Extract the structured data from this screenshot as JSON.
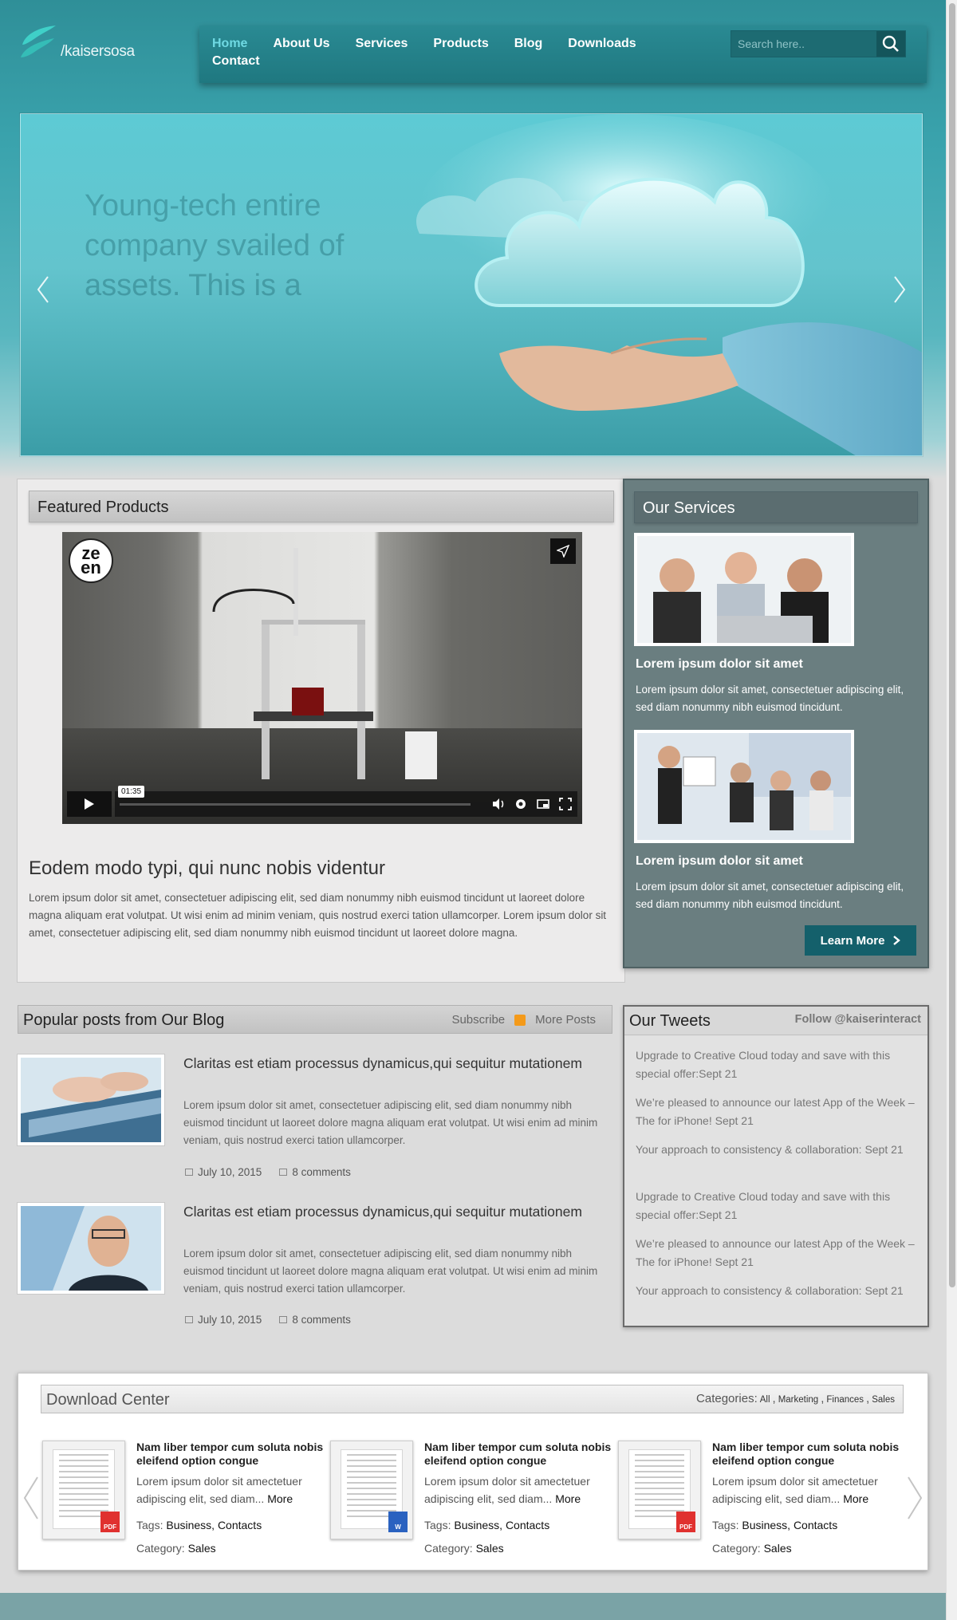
{
  "brand": {
    "logo_text": "/kaisersosa",
    "accent": "#2a8a93",
    "nav_active": "#6fd9e3"
  },
  "nav": {
    "items": [
      {
        "label": "Home",
        "active": true
      },
      {
        "label": "About Us"
      },
      {
        "label": "Services"
      },
      {
        "label": "Products"
      },
      {
        "label": "Blog"
      },
      {
        "label": "Downloads"
      },
      {
        "label": "Contact"
      }
    ]
  },
  "search": {
    "placeholder": "Search here..",
    "icon": "search-icon"
  },
  "hero": {
    "faded_text": "Young-tech entire company svailed of assets. This is a",
    "icons": [
      "chevron-left-icon",
      "chevron-right-icon"
    ]
  },
  "featured": {
    "title": "Featured Products",
    "video": {
      "badge": "ze en",
      "time": "01:35",
      "icons": [
        "play-icon",
        "volume-icon",
        "settings-icon",
        "pip-icon",
        "fullscreen-icon",
        "share-icon"
      ]
    },
    "headline": "Eodem modo typi, qui nunc nobis videntur",
    "body": "Lorem ipsum dolor sit amet, consectetuer adipiscing elit, sed diam nonummy nibh euismod tincidunt ut laoreet dolore magna aliquam erat volutpat. Ut wisi enim ad minim veniam, quis nostrud exerci tation ullamcorper. Lorem ipsum dolor sit amet, consectetuer adipiscing elit, sed diam nonummy nibh euismod tincidunt ut laoreet dolore magna."
  },
  "services": {
    "title": "Our Services",
    "items": [
      {
        "heading": "Lorem ipsum dolor sit amet",
        "text": "Lorem ipsum dolor sit amet, consectetuer adipiscing elit, sed diam nonummy nibh euismod tincidunt."
      },
      {
        "heading": "Lorem ipsum dolor sit amet",
        "text": "Lorem ipsum dolor sit amet, consectetuer adipiscing elit, sed diam nonummy nibh euismod tincidunt."
      }
    ],
    "learn_more": "Learn More"
  },
  "blog": {
    "title": "Popular posts from Our Blog",
    "subscribe": "Subscribe",
    "more_posts": "More Posts",
    "posts": [
      {
        "title": "Claritas est etiam processus dynamicus,qui sequitur mutationem",
        "body": "Lorem ipsum dolor sit amet, consectetuer adipiscing elit, sed diam nonummy nibh euismod tincidunt ut laoreet dolore magna aliquam erat volutpat. Ut wisi enim ad minim veniam, quis nostrud exerci tation ullamcorper.",
        "date": "July 10, 2015",
        "comments": "8 comments"
      },
      {
        "title": "Claritas est etiam processus dynamicus,qui sequitur mutationem",
        "body": "Lorem ipsum dolor sit amet, consectetuer adipiscing elit, sed diam nonummy nibh euismod tincidunt ut laoreet dolore magna aliquam erat volutpat. Ut wisi enim ad minim veniam, quis nostrud exerci tation ullamcorper.",
        "date": "July 10, 2015",
        "comments": "8 comments"
      }
    ]
  },
  "tweets": {
    "title": "Our Tweets",
    "follow": "Follow @kaiserinteract",
    "items": [
      "Upgrade to Creative Cloud today and save with this special offer:Sept 21",
      "We’re pleased to announce our latest App of the Week – The for iPhone! Sept 21",
      "Your approach to consistency & collaboration: Sept 21",
      "Upgrade to Creative Cloud today and save with this special offer:Sept 21",
      "We’re pleased to announce our latest App of the Week – The for iPhone! Sept 21",
      "Your approach to consistency & collaboration: Sept 21"
    ]
  },
  "downloads": {
    "title": "Download Center",
    "categories_label": "Categories:",
    "categories": [
      "All",
      "Marketing",
      "Finances",
      "Sales"
    ],
    "items": [
      {
        "name": "Nam liber tempor cum soluta nobis eleifend option congue",
        "desc": "Lorem ipsum dolor sit amectetuer adipiscing elit, sed diam...",
        "more": "More",
        "tags_label": "Tags:",
        "tags": "Business, Contacts",
        "category_label": "Category:",
        "category": "Sales",
        "type": "PDF",
        "type_color": "#e0312f"
      },
      {
        "name": "Nam liber tempor cum soluta nobis eleifend option congue",
        "desc": "Lorem ipsum dolor sit amectetuer adipiscing elit, sed diam...",
        "more": "More",
        "tags_label": "Tags:",
        "tags": "Business, Contacts",
        "category_label": "Category:",
        "category": "Sales",
        "type": "W",
        "type_color": "#2a62c0"
      },
      {
        "name": "Nam liber tempor cum soluta nobis eleifend option congue",
        "desc": "Lorem ipsum dolor sit amectetuer adipiscing elit, sed diam...",
        "more": "More",
        "tags_label": "Tags:",
        "tags": "Business, Contacts",
        "category_label": "Category:",
        "category": "Sales",
        "type": "PDF",
        "type_color": "#e0312f"
      }
    ]
  }
}
